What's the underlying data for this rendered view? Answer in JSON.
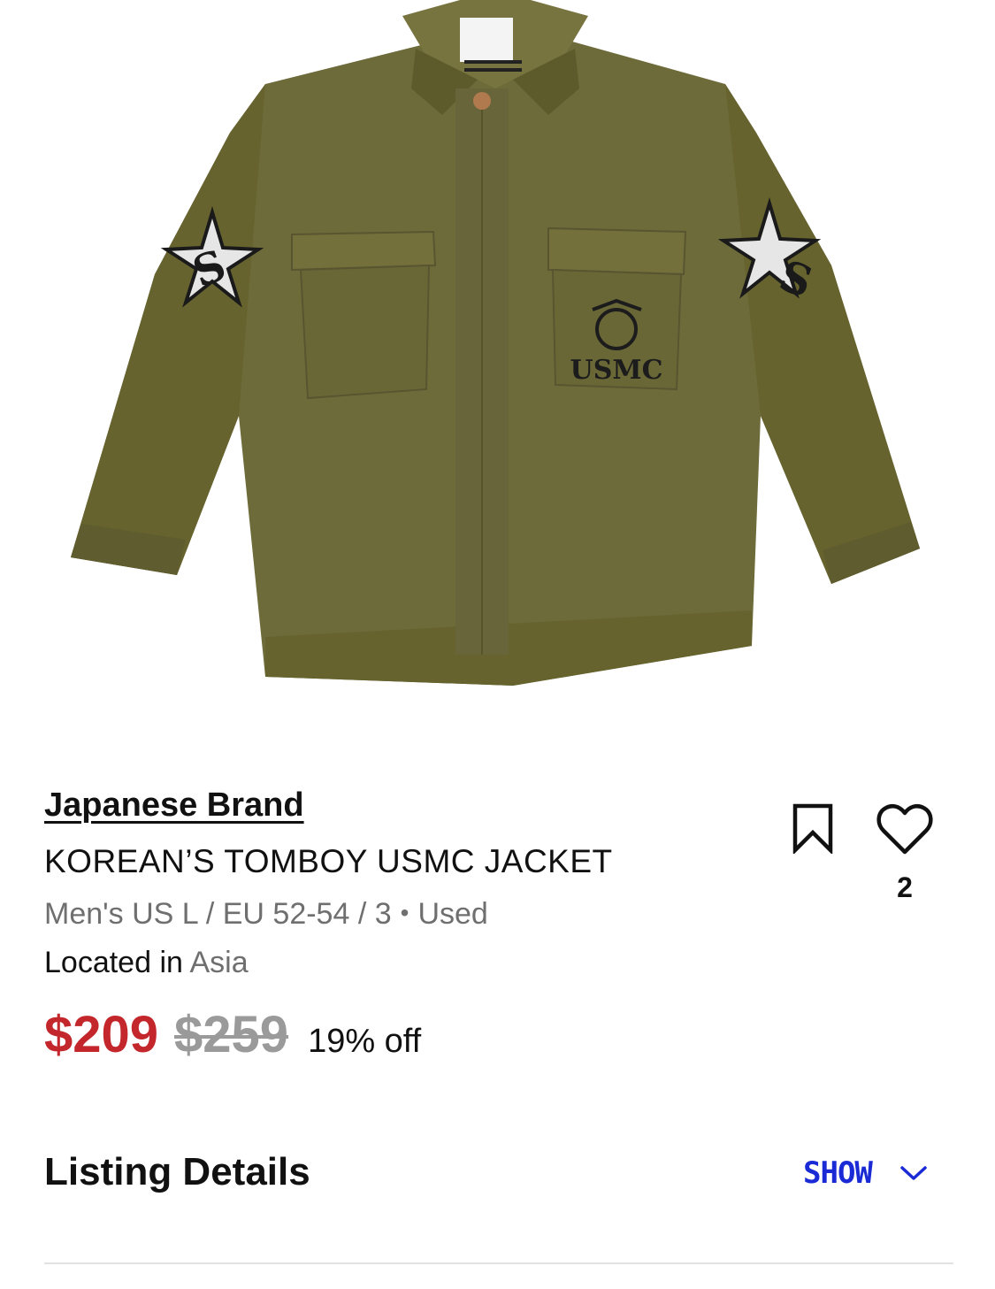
{
  "listing": {
    "brand": "Japanese Brand",
    "title": "KOREAN’S TOMBOY USMC JACKET",
    "size": "Men's US L / EU 52-54 / 3",
    "separator": "•",
    "condition": "Used",
    "location_label": "Located in",
    "location_value": "Asia",
    "price_current": "$209",
    "price_original": "$259",
    "discount": "19% off",
    "like_count": "2",
    "image": {
      "patch_text": "USMC",
      "colors": {
        "jacket": "#6e6b3a",
        "jacket_shadow": "#5a572e",
        "jacket_highlight": "#7c7944",
        "button": "#b07a4e"
      }
    }
  },
  "actions": {
    "save_icon": "bookmark-icon",
    "like_icon": "heart-icon"
  },
  "listing_details": {
    "title": "Listing Details",
    "toggle_label": "SHOW",
    "toggle_icon": "chevron-down-icon"
  },
  "colors": {
    "price_red": "#c3272b",
    "link_blue": "#1a2bd6",
    "muted_gray": "#6f6f6f",
    "divider": "#e2e2e2"
  }
}
